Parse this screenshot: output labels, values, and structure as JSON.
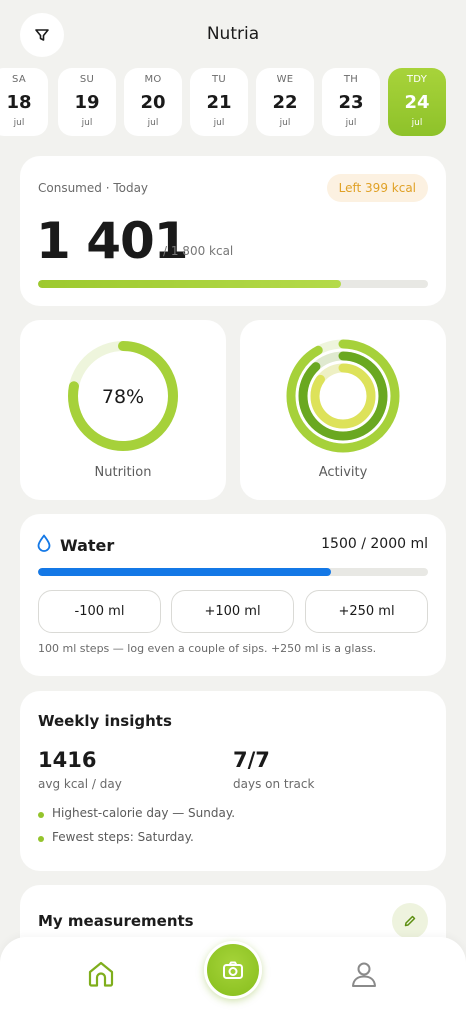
{
  "header": {
    "title": "Nutria",
    "filter_icon": "filter-icon"
  },
  "days": [
    {
      "dow": "SA",
      "num": "18",
      "mon": "jul",
      "active": false
    },
    {
      "dow": "SU",
      "num": "19",
      "mon": "jul",
      "active": false
    },
    {
      "dow": "MO",
      "num": "20",
      "mon": "jul",
      "active": false
    },
    {
      "dow": "TU",
      "num": "21",
      "mon": "jul",
      "active": false
    },
    {
      "dow": "WE",
      "num": "22",
      "mon": "jul",
      "active": false
    },
    {
      "dow": "TH",
      "num": "23",
      "mon": "jul",
      "active": false
    },
    {
      "dow": "TDY",
      "num": "24",
      "mon": "jul",
      "active": true
    }
  ],
  "consumed": {
    "label": "Consumed · Today",
    "left_badge": "Left 399 kcal",
    "value": "1 401",
    "goal": "/ 1 800 kcal",
    "progress": 0.778
  },
  "nutrition": {
    "percent_text": "78%",
    "percent": 0.78,
    "label": "Nutrition"
  },
  "activity": {
    "label": "Activity",
    "rings": [
      0.92,
      0.88,
      0.85
    ]
  },
  "water": {
    "title": "Water",
    "amount": "1500 / 2000 ml",
    "progress": 0.75,
    "buttons": [
      "-100 ml",
      "+100 ml",
      "+250 ml"
    ],
    "hint": "100 ml steps — log even a couple of sips. +250 ml is a glass."
  },
  "insights": {
    "title": "Weekly insights",
    "stat1_value": "1416",
    "stat1_label": "avg kcal / day",
    "stat2_value": "7/7",
    "stat2_label": "days on track",
    "bullets": [
      "Highest-calorie day — Sunday.",
      "Fewest steps: Saturday."
    ]
  },
  "measurements": {
    "title": "My measurements",
    "edit_icon": "pencil-icon"
  },
  "nav": {
    "home_icon": "home-icon",
    "camera_icon": "camera-icon",
    "profile_icon": "profile-icon"
  },
  "colors": {
    "accent": "#9dc92e",
    "water": "#1478e6",
    "badge_text": "#e0a126",
    "badge_bg": "#fcf1e1",
    "background": "#f2f2ef"
  }
}
